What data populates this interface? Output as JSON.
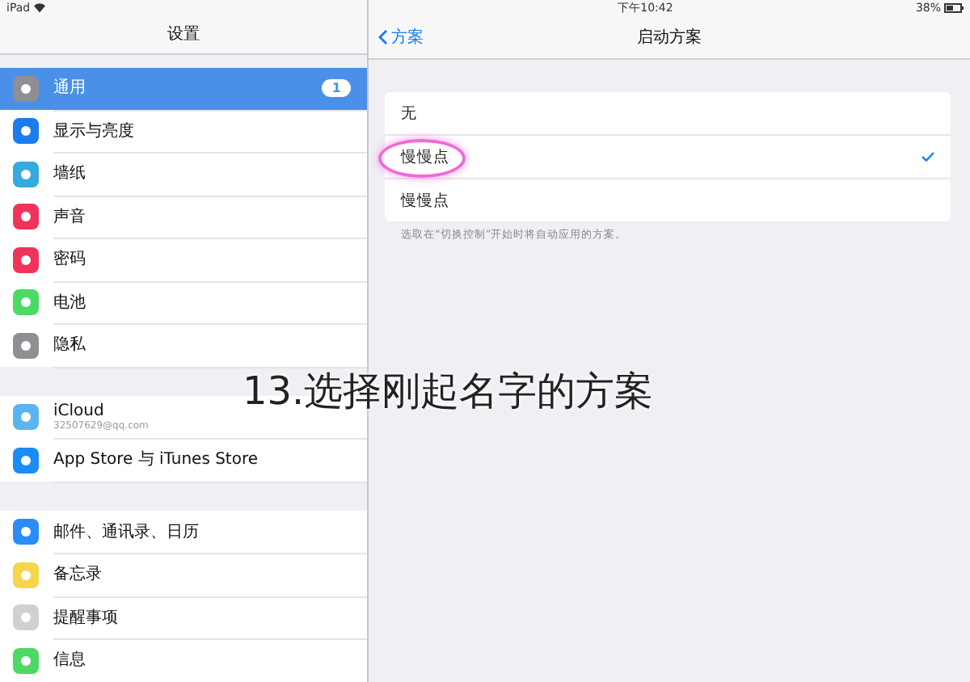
{
  "status_bar": {
    "device": "iPad",
    "time": "下午10:42",
    "battery": "38%"
  },
  "sidebar": {
    "title": "设置",
    "groups": [
      {
        "items": [
          {
            "label": "通用",
            "selected": true,
            "color": "#8e8e93",
            "badge": "1"
          },
          {
            "label": "显示与亮度",
            "selected": false,
            "color": "#1a7cf0"
          },
          {
            "label": "墙纸",
            "selected": false,
            "color": "#35aadc"
          },
          {
            "label": "声音",
            "selected": false,
            "color": "#f0335a"
          },
          {
            "label": "密码",
            "selected": false,
            "color": "#f0335a"
          },
          {
            "label": "电池",
            "selected": false,
            "color": "#4cd964"
          },
          {
            "label": "隐私",
            "selected": false,
            "color": "#8e8e93"
          }
        ]
      },
      {
        "items": [
          {
            "label": "iCloud",
            "selected": false,
            "color": "#5ab4f0",
            "subtitle": "32507629@qq.com"
          },
          {
            "label": "App Store 与 iTunes Store",
            "selected": false,
            "color": "#1a8cf5"
          }
        ]
      },
      {
        "items": [
          {
            "label": "邮件、通讯录、日历",
            "selected": false,
            "color": "#2a8cf5"
          },
          {
            "label": "备忘录",
            "selected": false,
            "color": "#f7d54a"
          },
          {
            "label": "提醒事项",
            "selected": false,
            "color": "#d0d0d0"
          },
          {
            "label": "信息",
            "selected": false,
            "color": "#4cd964"
          }
        ]
      }
    ]
  },
  "detail": {
    "back": "方案",
    "title": "启动方案",
    "options": [
      {
        "label": "无",
        "selected": false,
        "circled": false
      },
      {
        "label": "慢慢点",
        "selected": true,
        "circled": true
      },
      {
        "label": "慢慢点",
        "selected": false,
        "circled": false
      }
    ],
    "footer": "选取在“切换控制”开始时将自动应用的方案。"
  },
  "caption": "13.选择刚起名字的方案"
}
